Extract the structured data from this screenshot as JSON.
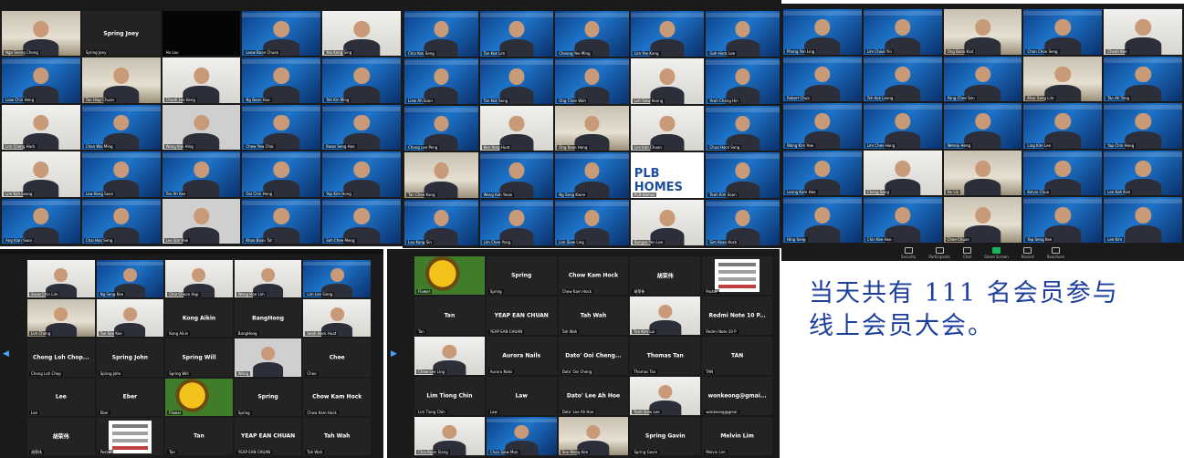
{
  "panels": {
    "p1": {
      "tiles": [
        {
          "kind": "room",
          "caption": "Ngo Seong Chong"
        },
        {
          "kind": "dark",
          "name": "Spring Joey",
          "caption": "Spring Joey"
        },
        {
          "kind": "black",
          "caption": "Ho Lau"
        },
        {
          "kind": "cam",
          "caption": "Leow Boon Chuan"
        },
        {
          "kind": "white",
          "caption": "Yeo Keng Sing"
        },
        {
          "kind": "cam",
          "caption": "Liew Chin Heng"
        },
        {
          "kind": "room",
          "caption": "Tan Hiap Chuan"
        },
        {
          "kind": "white",
          "caption": "Cheah Lee Keng"
        },
        {
          "kind": "cam",
          "caption": "Ng Boon Hua"
        },
        {
          "kind": "cam",
          "caption": "Teh Kin Ming"
        },
        {
          "kind": "white",
          "caption": "Lim Cheng Hock"
        },
        {
          "kind": "cam",
          "caption": "Chan Wai Ming"
        },
        {
          "kind": "gray",
          "caption": "Wong Kok Hing"
        },
        {
          "kind": "cam",
          "caption": "Chew Yew Chai"
        },
        {
          "kind": "cam",
          "caption": "Kwan Seng Hoo"
        },
        {
          "kind": "white",
          "caption": "Lim Kah Leong"
        },
        {
          "kind": "cam",
          "caption": "Low Kong Soon"
        },
        {
          "kind": "cam",
          "caption": "Tee Ah Kee"
        },
        {
          "kind": "cam",
          "caption": "Ooi Chin Heng"
        },
        {
          "kind": "cam",
          "caption": "Yap Kim Hong"
        },
        {
          "kind": "cam",
          "caption": "Ang Kian Soon"
        },
        {
          "kind": "cam",
          "caption": "Chai Hoo Seng"
        },
        {
          "kind": "gray",
          "caption": "Lee Sze Yew"
        },
        {
          "kind": "cam",
          "caption": "Khoo Boon Tat"
        },
        {
          "kind": "cam",
          "caption": "Soh Chee Meng"
        }
      ]
    },
    "p2": {
      "tiles": [
        {
          "kind": "cam",
          "caption": "Chin Kok Seng"
        },
        {
          "kind": "cam",
          "caption": "Tan Kok Lim"
        },
        {
          "kind": "cam",
          "caption": "Cheong Yee Ming"
        },
        {
          "kind": "cam",
          "caption": "Lim Yee Kang"
        },
        {
          "kind": "cam",
          "caption": "Goh Hock Lee"
        },
        {
          "kind": "cam",
          "caption": "Liew Ah Soon"
        },
        {
          "kind": "cam",
          "caption": "Tan Kok Seng"
        },
        {
          "kind": "cam",
          "caption": "Ong Chee Wah"
        },
        {
          "kind": "white",
          "caption": "Loh Siew Keong"
        },
        {
          "kind": "cam",
          "caption": "Yeoh Cheng Hin"
        },
        {
          "kind": "cam",
          "caption": "Chong Lee Peng"
        },
        {
          "kind": "white",
          "caption": "Kee Yong Huat"
        },
        {
          "kind": "room",
          "caption": "Ong Kean Heng"
        },
        {
          "kind": "white",
          "caption": "Lim Kah Chuan"
        },
        {
          "kind": "cam",
          "caption": "Chua Hock Seng"
        },
        {
          "kind": "room",
          "caption": "Tan Chee Kong"
        },
        {
          "kind": "cam",
          "caption": "Wong Kah Yeow"
        },
        {
          "kind": "cam",
          "caption": "Ng Seng Kwee"
        },
        {
          "kind": "plb",
          "caption": "PLB Homes"
        },
        {
          "kind": "cam",
          "caption": "Teoh Kim Soon"
        },
        {
          "kind": "cam",
          "caption": "Lau Kong Sin"
        },
        {
          "kind": "cam",
          "caption": "Lim Chee Yong"
        },
        {
          "kind": "cam",
          "caption": "Lim Siew Ling"
        },
        {
          "kind": "white",
          "caption": "Bangsa Yen Lee"
        },
        {
          "kind": "cam",
          "caption": "Sim Kean Hock"
        }
      ]
    },
    "p3": {
      "tiles": [
        {
          "kind": "cam",
          "caption": "Phang Yen Ling"
        },
        {
          "kind": "cam",
          "caption": "Lim Chooi Yin"
        },
        {
          "kind": "room",
          "caption": "Ong Boon Kiat"
        },
        {
          "kind": "cam",
          "caption": "Chan Choo Seng"
        },
        {
          "kind": "white",
          "caption": "Cheah Kee"
        },
        {
          "kind": "cam",
          "caption": "Robert Chua"
        },
        {
          "kind": "cam",
          "caption": "Teh Kok Leong"
        },
        {
          "kind": "cam",
          "caption": "Pang Chee Sen"
        },
        {
          "kind": "room",
          "caption": "Khor Seng Lim"
        },
        {
          "kind": "cam",
          "caption": "Tan Ah Teng"
        },
        {
          "kind": "cam",
          "caption": "Wong Kim Yew"
        },
        {
          "kind": "cam",
          "caption": "Lim Chee Hong"
        },
        {
          "kind": "cam",
          "caption": "Wendy Heng"
        },
        {
          "kind": "cam",
          "caption": "Ling Kim Lee"
        },
        {
          "kind": "cam",
          "caption": "Yap Chin Hong"
        },
        {
          "kind": "cam",
          "caption": "Leong Kam Hee"
        },
        {
          "kind": "white",
          "caption": "Chong Seng"
        },
        {
          "kind": "room",
          "caption": "Ho Lik"
        },
        {
          "kind": "cam",
          "caption": "Kelvin Chua"
        },
        {
          "kind": "cam",
          "caption": "Lee Kah Kiat"
        },
        {
          "kind": "cam",
          "caption": "Hing Seng"
        },
        {
          "kind": "cam",
          "caption": "Chin Kee Hoe"
        },
        {
          "kind": "room",
          "caption": "Chee Chuan"
        },
        {
          "kind": "cam",
          "caption": "Yap Seng Kee"
        },
        {
          "kind": "cam",
          "caption": "Lee Kim"
        }
      ],
      "controls": [
        "Security",
        "Participants",
        "Chat",
        "Share Screen",
        "Record",
        "Reactions"
      ]
    },
    "p4": {
      "tiles": [
        {
          "kind": "white",
          "caption": "Seow Chin Lim"
        },
        {
          "kind": "cam",
          "caption": "Ng Seng Kee"
        },
        {
          "kind": "white",
          "caption": "Chin Choon Hup"
        },
        {
          "kind": "white",
          "caption": "Wong Hoe Lim"
        },
        {
          "kind": "cam",
          "caption": "Lim Lee Sieng"
        },
        {
          "kind": "room",
          "caption": "Lim Cheng"
        },
        {
          "kind": "white",
          "caption": "Tan Soo Kee"
        },
        {
          "kind": "dark",
          "name": "Kong Aikin",
          "caption": "Kong Aikin"
        },
        {
          "kind": "dark",
          "name": "BangHong",
          "caption": "BangHong"
        },
        {
          "kind": "white",
          "caption": "Seah Hock Huat"
        },
        {
          "kind": "dark",
          "name": "Chong Loh Chop...",
          "caption": "Chong Loh Chop"
        },
        {
          "kind": "dark",
          "name": "Spring John",
          "caption": "Spring John"
        },
        {
          "kind": "dark",
          "name": "Spring Will",
          "caption": "Spring Will"
        },
        {
          "kind": "gray",
          "caption": "Wong"
        },
        {
          "kind": "dark",
          "name": "Chee",
          "caption": "Chee"
        },
        {
          "kind": "dark",
          "name": "Lee",
          "caption": "Lee"
        },
        {
          "kind": "dark",
          "name": "Eber",
          "caption": "Eber"
        },
        {
          "kind": "flower",
          "caption": "Flower"
        },
        {
          "kind": "dark",
          "name": "Spring",
          "caption": "Spring"
        },
        {
          "kind": "dark",
          "name": "Chow Kam Hock",
          "caption": "Chow Kam Hock"
        },
        {
          "kind": "dark",
          "name": "胡荣伟",
          "caption": "胡荣伟"
        },
        {
          "kind": "poster",
          "caption": "Poster"
        },
        {
          "kind": "dark",
          "name": "Tan",
          "caption": "Tan"
        },
        {
          "kind": "dark",
          "name": "YEAP EAN CHUAN",
          "caption": "YEAP EAN CHUAN"
        },
        {
          "kind": "dark",
          "name": "Tah Wah",
          "caption": "Tah Wah"
        }
      ]
    },
    "p5": {
      "tiles": [
        {
          "kind": "flower",
          "caption": "Flower"
        },
        {
          "kind": "dark",
          "name": "Spring",
          "caption": "Spring"
        },
        {
          "kind": "dark",
          "name": "Chow Kam Hock",
          "caption": "Chow Kam Hock"
        },
        {
          "kind": "dark",
          "name": "胡荣伟",
          "caption": "胡荣伟"
        },
        {
          "kind": "poster",
          "caption": "Poster"
        },
        {
          "kind": "dark",
          "name": "Tan",
          "caption": "Tan"
        },
        {
          "kind": "dark",
          "name": "YEAP EAN CHUAN",
          "caption": "YEAP EAN CHUAN"
        },
        {
          "kind": "dark",
          "name": "Tah Wah",
          "caption": "Tah Wah"
        },
        {
          "kind": "white",
          "caption": "Tan Kim Lai"
        },
        {
          "kind": "dark",
          "name": "Redmi Note 10 P...",
          "caption": "Redmi Note 10 P"
        },
        {
          "kind": "white",
          "caption": "Chew Lee Ling"
        },
        {
          "kind": "dark",
          "name": "Aurora Nails",
          "caption": "Aurora Nails"
        },
        {
          "kind": "dark",
          "name": "Dato' Ooi Cheng...",
          "caption": "Dato' Ooi Cheng"
        },
        {
          "kind": "dark",
          "name": "Thomas Tan",
          "caption": "Thomas Tan"
        },
        {
          "kind": "dark",
          "name": "TAN",
          "caption": "TAN"
        },
        {
          "kind": "dark",
          "name": "Lim Tiong Chin",
          "caption": "Lim Tiong Chin"
        },
        {
          "kind": "dark",
          "name": "Law",
          "caption": "Law"
        },
        {
          "kind": "dark",
          "name": "Dato' Lee Ah Hoe",
          "caption": "Dato' Lee Ah Hoe"
        },
        {
          "kind": "white",
          "caption": "Teoh Siew Lee"
        },
        {
          "kind": "dark",
          "name": "wonkeong@gmai...",
          "caption": "wonkeong@gmai"
        },
        {
          "kind": "white",
          "caption": "Chia Boon Siang"
        },
        {
          "kind": "cam",
          "caption": "Chan Siew Mun"
        },
        {
          "kind": "room",
          "caption": "Soo Weng Kee"
        },
        {
          "kind": "dark",
          "name": "Spring Gavin",
          "caption": "Spring Gavin"
        },
        {
          "kind": "dark",
          "name": "Melvin Lim",
          "caption": "Melvin Lim"
        }
      ]
    }
  },
  "caption": {
    "line1": "当天共有 111 名会员参与",
    "line2": "线上会员大会。"
  },
  "colors": {
    "caption": "#1c3f9e",
    "zoom_bg": "#1a1a1a",
    "share": "#18b65a"
  },
  "icons": {
    "prev": "chevron-left-icon",
    "next": "chevron-right-icon"
  }
}
